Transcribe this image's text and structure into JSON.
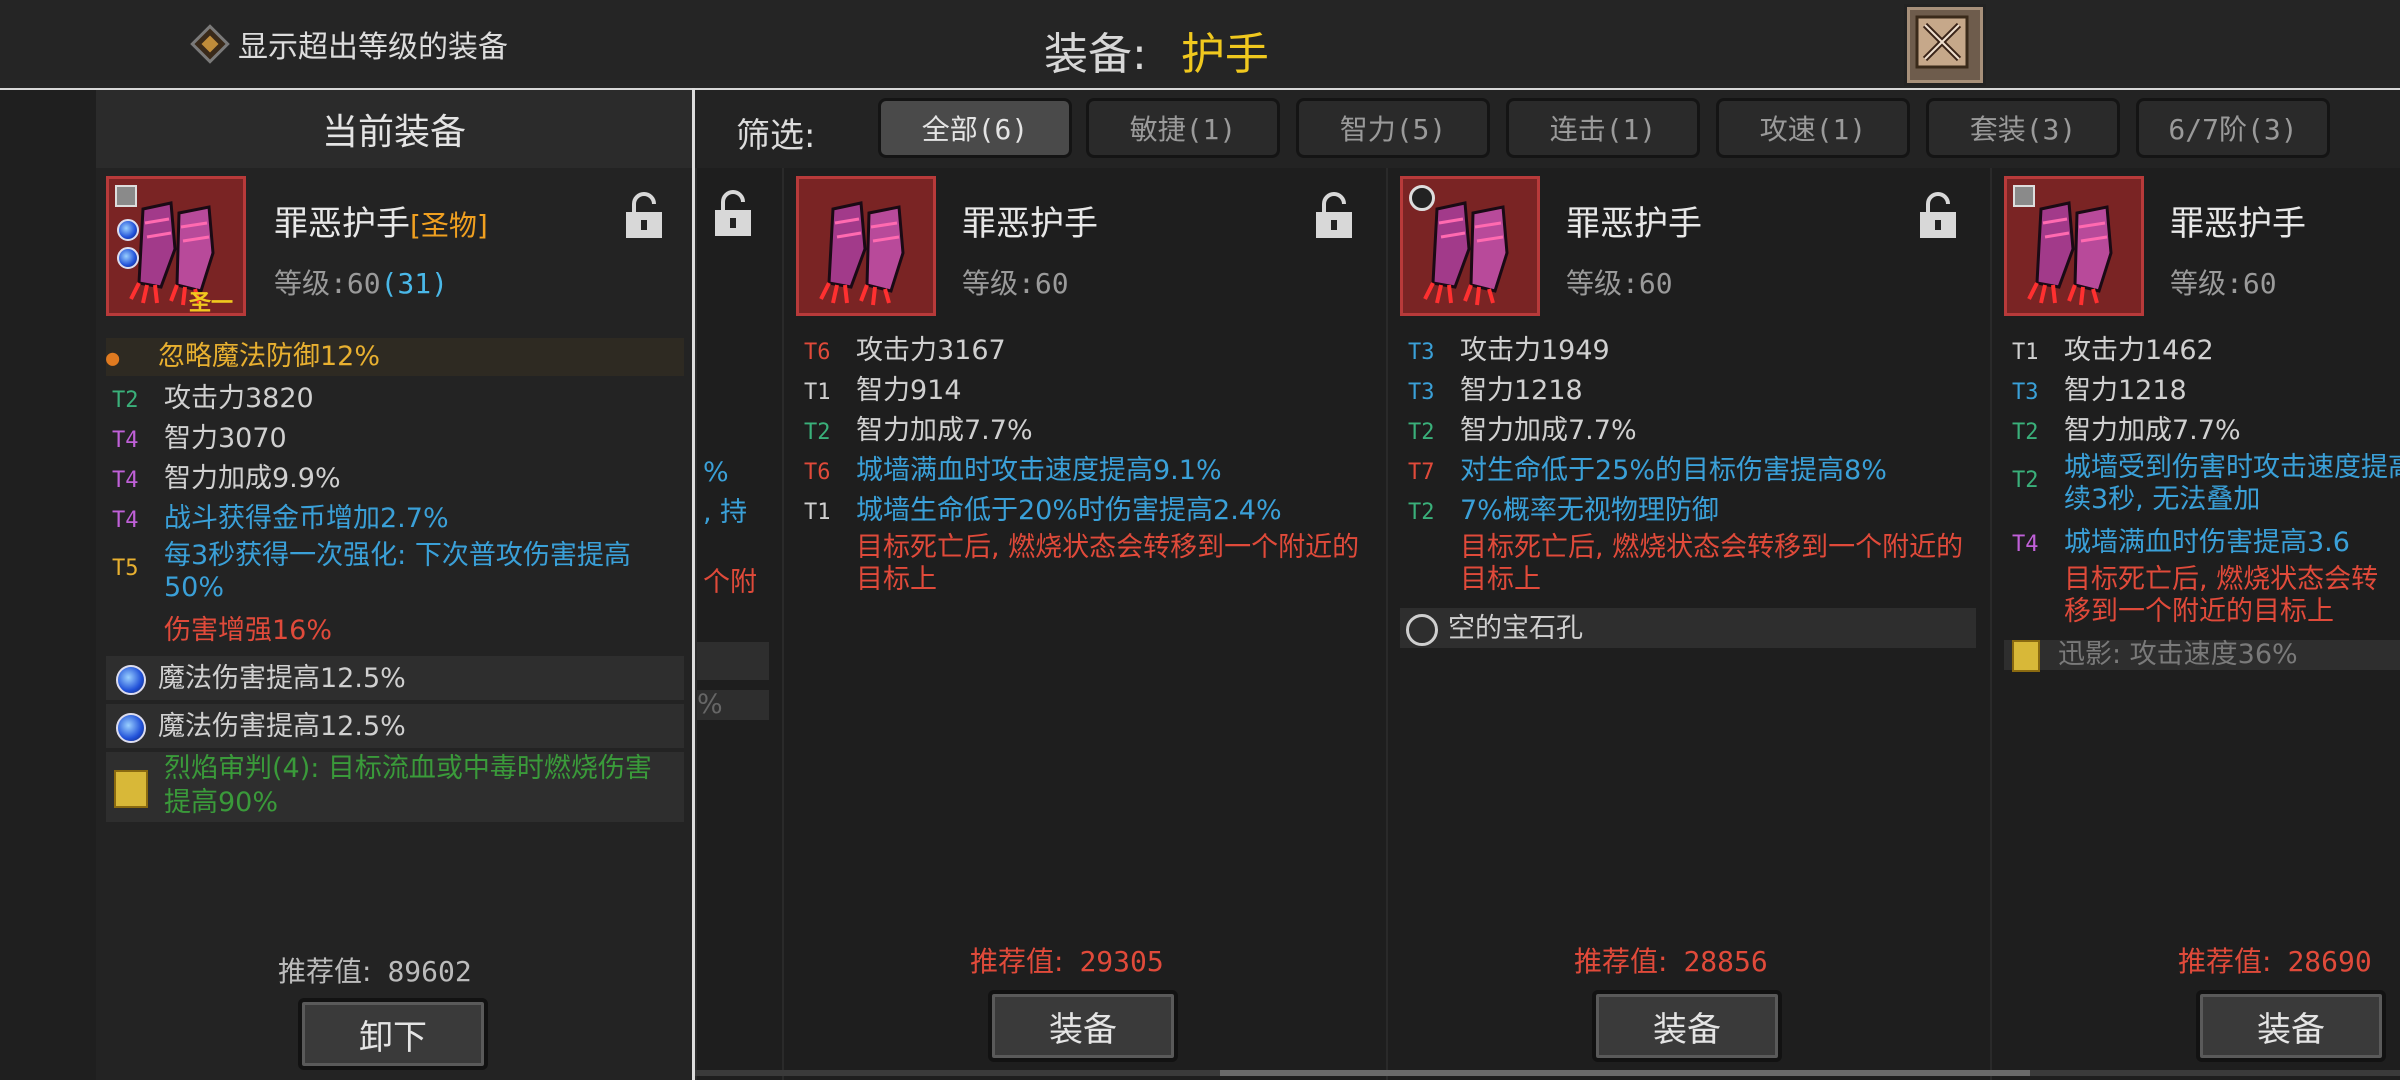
{
  "top": {
    "show_over_label": "显示超出等级的装备",
    "title_label": "装备:",
    "title_value": "护手"
  },
  "current": {
    "header": "当前装备",
    "name": "罪恶护手",
    "tag": "[圣物]",
    "level_label": "等级:60",
    "level_extra": "(31)",
    "icon_badge": "圣一",
    "special": "忽略魔法防御12%",
    "stats": [
      {
        "tier": "T2",
        "text": "攻击力3820"
      },
      {
        "tier": "T4",
        "text": "智力3070"
      },
      {
        "tier": "T4",
        "text": "智力加成9.9%"
      },
      {
        "tier": "T4",
        "text": "战斗获得金币增加2.7%"
      },
      {
        "tier": "T5",
        "text": "每3秒获得一次强化: 下次普攻伤害提高50%"
      }
    ],
    "extra_red": "伤害增强16%",
    "gems": [
      "魔法伤害提高12.5%",
      "魔法伤害提高12.5%"
    ],
    "set_text": "烈焰审判(4): 目标流血或中毒时燃烧伤害提高90%",
    "score_label": "推荐值:",
    "score_value": "89602",
    "button": "卸下"
  },
  "filter": {
    "label": "筛选:",
    "tabs": [
      "全部(6)",
      "敏捷(1)",
      "智力(5)",
      "连击(1)",
      "攻速(1)",
      "套装(3)",
      "6/7阶(3)"
    ]
  },
  "partial_left": {
    "fragments": [
      "%",
      ", 持",
      "个附",
      "%"
    ]
  },
  "cards": [
    {
      "name": "罪恶护手",
      "level": "等级:60",
      "stats": [
        {
          "tier": "T6",
          "text": "攻击力3167"
        },
        {
          "tier": "T1",
          "text": "智力914"
        },
        {
          "tier": "T2",
          "text": "智力加成7.7%"
        },
        {
          "tier": "T6",
          "text": "城墙满血时攻击速度提高9.1%"
        },
        {
          "tier": "T1",
          "text": "城墙生命低于20%时伤害提高2.4%"
        }
      ],
      "red_text": "目标死亡后, 燃烧状态会转移到一个附近的目标上",
      "score_label": "推荐值:",
      "score_value": "29305",
      "button": "装备"
    },
    {
      "name": "罪恶护手",
      "level": "等级:60",
      "stats": [
        {
          "tier": "T3",
          "text": "攻击力1949"
        },
        {
          "tier": "T3",
          "text": "智力1218"
        },
        {
          "tier": "T2",
          "text": "智力加成7.7%"
        },
        {
          "tier": "T7",
          "text": "对生命低于25%的目标伤害提高8%"
        },
        {
          "tier": "T2",
          "text": "7%概率无视物理防御"
        }
      ],
      "red_text": "目标死亡后, 燃烧状态会转移到一个附近的目标上",
      "empty_gem": "空的宝石孔",
      "score_label": "推荐值:",
      "score_value": "28856",
      "button": "装备"
    },
    {
      "name": "罪恶护手",
      "level": "等级:60",
      "stats": [
        {
          "tier": "T1",
          "text": "攻击力1462"
        },
        {
          "tier": "T3",
          "text": "智力1218"
        },
        {
          "tier": "T2",
          "text": "智力加成7.7%"
        },
        {
          "tier": "T2",
          "text": "城墙受到伤害时攻击速度提高续3秒, 无法叠加"
        },
        {
          "tier": "T4",
          "text": "城墙满血时伤害提高3.6"
        }
      ],
      "red_text": "目标死亡后, 燃烧状态会转移到一个附近的目标上",
      "set_text": "迅影: 攻击速度36%",
      "score_label": "推荐值:",
      "score_value": "28690",
      "button": "装备"
    }
  ]
}
